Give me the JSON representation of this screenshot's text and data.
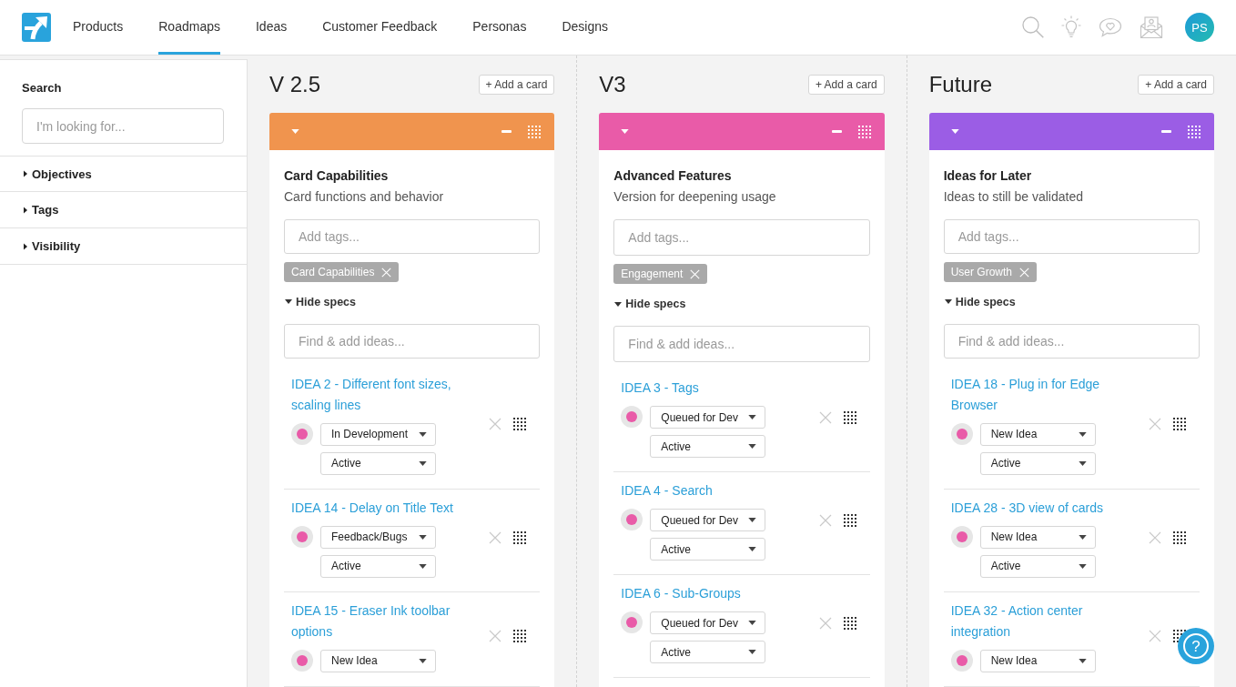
{
  "nav": {
    "tabs": [
      {
        "label": "Products",
        "selected": false
      },
      {
        "label": "Roadmaps",
        "selected": true
      },
      {
        "label": "Ideas",
        "selected": false
      },
      {
        "label": "Customer Feedback",
        "selected": false
      },
      {
        "label": "Personas",
        "selected": false
      },
      {
        "label": "Designs",
        "selected": false
      }
    ],
    "avatar": {
      "initials": "PS"
    }
  },
  "sidebar": {
    "search": {
      "label": "Search",
      "placeholder": "I'm looking for..."
    },
    "filters": [
      {
        "label": "Objectives",
        "expanded": false
      },
      {
        "label": "Tags",
        "expanded": false
      },
      {
        "label": "Visibility",
        "expanded": false
      }
    ]
  },
  "columns": [
    {
      "title": "V 2.5",
      "add_button": "+ Add a card",
      "card": {
        "color": "#f0944e",
        "title": "Card Capabilities",
        "subtitle": "Card functions and behavior",
        "tag_placeholder": "Add tags...",
        "tags": [
          {
            "label": "Card Capabilities"
          }
        ],
        "specs_toggle": "Hide specs",
        "idea_placeholder": "Find & add ideas...",
        "ideas": [
          {
            "title": "IDEA 2 - Different font sizes, scaling lines",
            "color": "#e95ba8",
            "stage": "In Development",
            "status": "Active"
          },
          {
            "title": "IDEA 14 - Delay on Title Text",
            "color": "#e95ba8",
            "stage": "Feedback/Bugs",
            "status": "Active"
          },
          {
            "title": "IDEA 15 - Eraser Ink toolbar options",
            "color": "#e95ba8",
            "stage": "New Idea"
          }
        ]
      }
    },
    {
      "title": "V3",
      "add_button": "+ Add a card",
      "card": {
        "color": "#e95ba8",
        "title": "Advanced Features",
        "subtitle": "Version for deepening usage",
        "tag_placeholder": "Add tags...",
        "tags": [
          {
            "label": "Engagement"
          }
        ],
        "specs_toggle": "Hide specs",
        "idea_placeholder": "Find & add ideas...",
        "ideas": [
          {
            "title": "IDEA 3 - Tags",
            "color": "#e95ba8",
            "stage": "Queued for Dev",
            "status": "Active"
          },
          {
            "title": "IDEA 4 - Search",
            "color": "#e95ba8",
            "stage": "Queued for Dev",
            "status": "Active"
          },
          {
            "title": "IDEA 6 - Sub-Groups",
            "color": "#e95ba8",
            "stage": "Queued for Dev",
            "status": "Active"
          }
        ]
      }
    },
    {
      "title": "Future",
      "add_button": "+ Add a card",
      "card": {
        "color": "#9b5de5",
        "title": "Ideas for Later",
        "subtitle": "Ideas to still be validated",
        "tag_placeholder": "Add tags...",
        "tags": [
          {
            "label": "User Growth"
          }
        ],
        "specs_toggle": "Hide specs",
        "idea_placeholder": "Find & add ideas...",
        "ideas": [
          {
            "title": "IDEA 18 - Plug in for Edge Browser",
            "color": "#e95ba8",
            "stage": "New Idea",
            "status": "Active"
          },
          {
            "title": "IDEA 28 - 3D view of cards",
            "color": "#e95ba8",
            "stage": "New Idea",
            "status": "Active"
          },
          {
            "title": "IDEA 32 - Action center integration",
            "color": "#e95ba8",
            "stage": "New Idea"
          }
        ]
      }
    }
  ],
  "help_button": {
    "label": "?"
  }
}
